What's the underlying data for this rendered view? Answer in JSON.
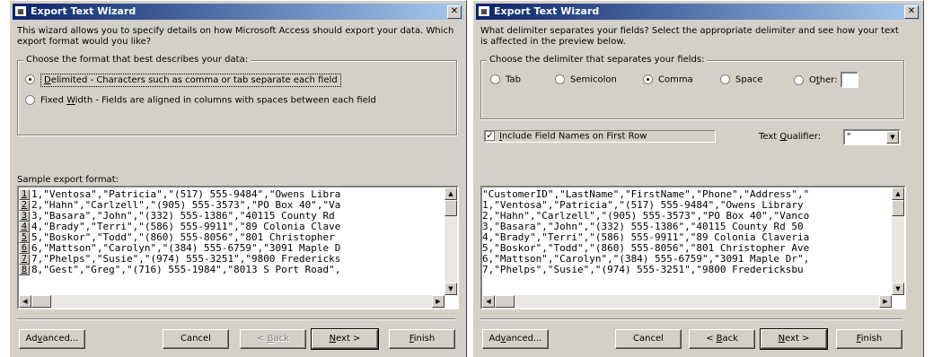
{
  "wizard1": {
    "title": "Export Text Wizard",
    "close_glyph": "✕",
    "intro": "This wizard allows you to specify details on how Microsoft Access should export your data. Which export format would you like?",
    "group_label": "Choose the format that best describes your data:",
    "option_delimited_key": "D",
    "option_delimited_rest": "elimited - Characters such as comma or tab separate each field",
    "option_fixed_pre": "Fixed ",
    "option_fixed_key": "W",
    "option_fixed_rest": "idth - Fields are aligned in columns with spaces between each field",
    "sample_label": "Sample export format:",
    "row_numbers": [
      "1",
      "2",
      "3",
      "4",
      "5",
      "6",
      "7",
      "8"
    ],
    "sample_lines": [
      "1,\"Ventosa\",\"Patricia\",\"(517) 555-9484\",\"Owens Libra",
      "2,\"Hahn\",\"Carlzell\",\"(905) 555-3573\",\"PO Box 40\",\"Va",
      "3,\"Basara\",\"John\",\"(332) 555-1386\",\"40115 County Rd",
      "4,\"Brady\",\"Terri\",\"(586) 555-9911\",\"89 Colonia Clave",
      "5,\"Boskor\",\"Todd\",\"(860) 555-8056\",\"801 Christopher",
      "6,\"Mattson\",\"Carolyn\",\"(384) 555-6759\",\"3091 Maple D",
      "7,\"Phelps\",\"Susie\",\"(974) 555-3251\",\"9800 Fredericks",
      "8,\"Gest\",\"Greg\",\"(716) 555-1984\",\"8013 S Port Road\","
    ],
    "buttons": {
      "advanced_pre": "Ad",
      "advanced_key": "v",
      "advanced_rest": "anced...",
      "cancel": "Cancel",
      "back_pre": "< ",
      "back_key": "B",
      "back_rest": "ack",
      "next_key": "N",
      "next_rest": "ext >",
      "finish_key": "F",
      "finish_rest": "inish"
    }
  },
  "wizard2": {
    "title": "Export Text Wizard",
    "close_glyph": "✕",
    "intro": "What delimiter separates your fields? Select the appropriate delimiter and see how your text is affected in the preview below.",
    "group_label": "Choose the delimiter that separates your fields:",
    "delimiters": {
      "tab": "Tab",
      "semicolon": "Semicolon",
      "comma": "Comma",
      "space": "Space",
      "other_pre": "O",
      "other_key": "t",
      "other_rest": "her:"
    },
    "include_pre": "",
    "include_key": "I",
    "include_rest": "nclude Field Names on First Row",
    "include_check": "✓",
    "qualifier_pre": "Text ",
    "qualifier_key": "Q",
    "qualifier_rest": "ualifier:",
    "qualifier_value": "\"",
    "preview_lines": [
      "\"CustomerID\",\"LastName\",\"FirstName\",\"Phone\",\"Address\",\"",
      "1,\"Ventosa\",\"Patricia\",\"(517) 555-9484\",\"Owens Library",
      "2,\"Hahn\",\"Carlzell\",\"(905) 555-3573\",\"PO Box 40\",\"Vanco",
      "3,\"Basara\",\"John\",\"(332) 555-1386\",\"40115 County Rd 50",
      "4,\"Brady\",\"Terri\",\"(586) 555-9911\",\"89 Colonia Claveria",
      "5,\"Boskor\",\"Todd\",\"(860) 555-8056\",\"801 Christopher Ave",
      "6,\"Mattson\",\"Carolyn\",\"(384) 555-6759\",\"3091 Maple Dr\",",
      "7,\"Phelps\",\"Susie\",\"(974) 555-3251\",\"9800 Fredericksbu"
    ],
    "buttons": {
      "advanced_pre": "Ad",
      "advanced_key": "v",
      "advanced_rest": "anced...",
      "cancel": "Cancel",
      "back_pre": "< ",
      "back_key": "B",
      "back_rest": "ack",
      "next_key": "N",
      "next_rest": "ext >",
      "finish_key": "F",
      "finish_rest": "inish"
    }
  },
  "icons": {
    "window": "▦",
    "up": "▲",
    "down": "▼",
    "left": "◀",
    "right": "▶"
  }
}
